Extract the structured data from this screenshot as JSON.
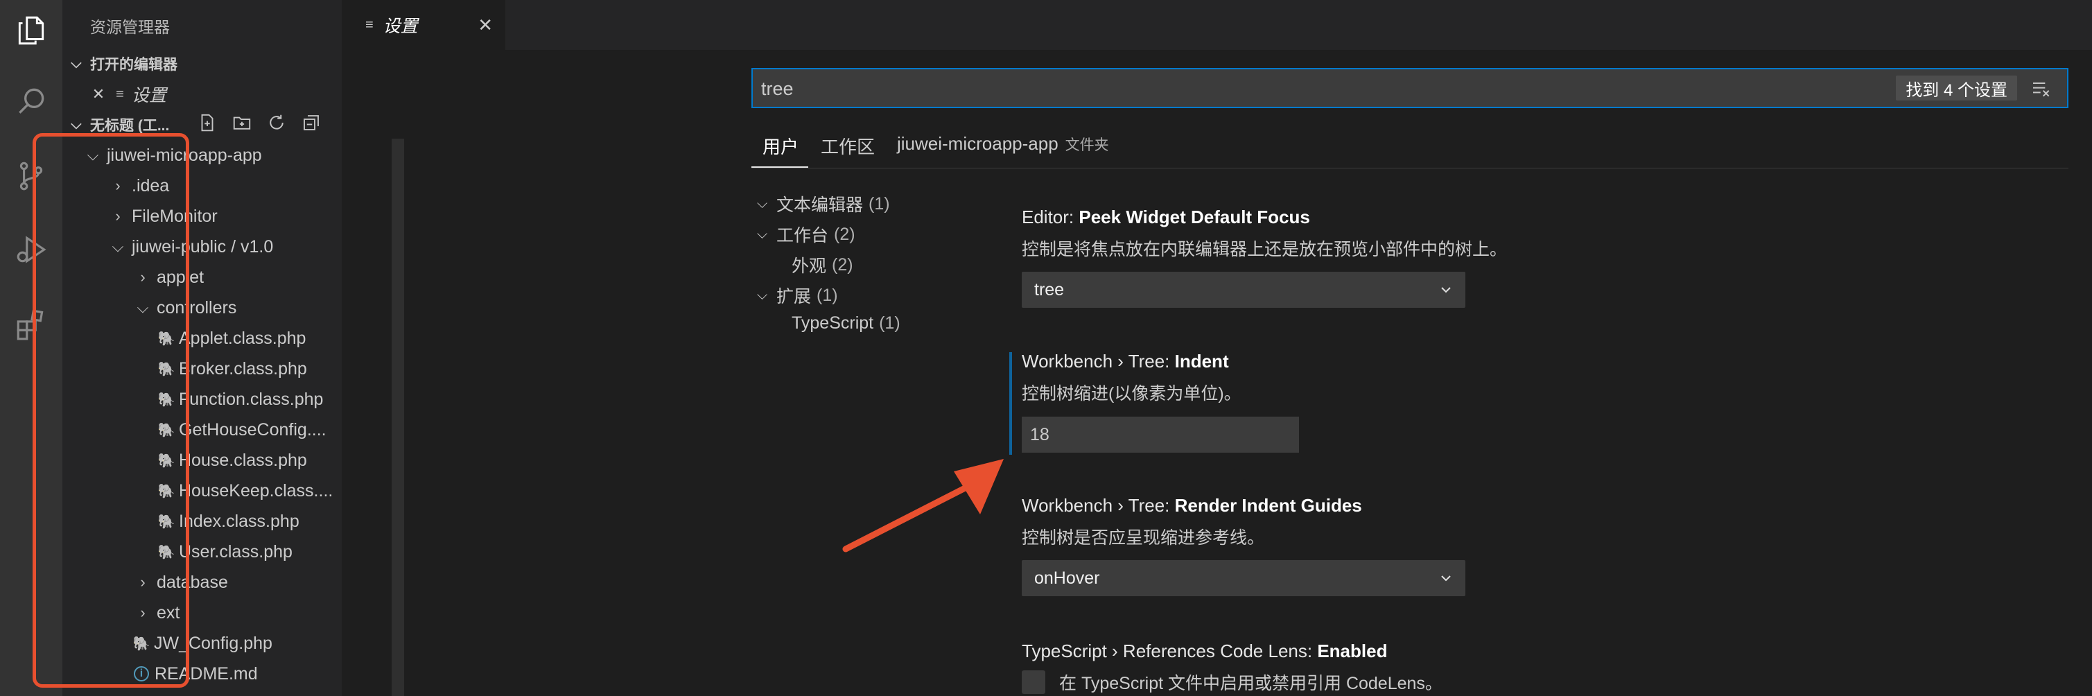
{
  "sidebar": {
    "title": "资源管理器",
    "open_editors_label": "打开的编辑器",
    "open_editor_item": "设置",
    "workspace_label": "无标题 (工...",
    "tree": [
      {
        "label": "jiuwei-microapp-app",
        "kind": "folder-open"
      },
      {
        "label": ".idea",
        "kind": "folder"
      },
      {
        "label": "FileMonitor",
        "kind": "folder"
      },
      {
        "label": "jiuwei-public / v1.0",
        "kind": "folder-open"
      },
      {
        "label": "applet",
        "kind": "folder"
      },
      {
        "label": "controllers",
        "kind": "folder-open"
      },
      {
        "label": "Applet.class.php",
        "kind": "php"
      },
      {
        "label": "Broker.class.php",
        "kind": "php"
      },
      {
        "label": "Function.class.php",
        "kind": "php"
      },
      {
        "label": "GetHouseConfig....",
        "kind": "php"
      },
      {
        "label": "House.class.php",
        "kind": "php"
      },
      {
        "label": "HouseKeep.class....",
        "kind": "php"
      },
      {
        "label": "Index.class.php",
        "kind": "php"
      },
      {
        "label": "User.class.php",
        "kind": "php"
      },
      {
        "label": "database",
        "kind": "folder"
      },
      {
        "label": "ext",
        "kind": "folder"
      },
      {
        "label": "JW_Config.php",
        "kind": "php"
      },
      {
        "label": "README.md",
        "kind": "info"
      }
    ]
  },
  "editor_tab": {
    "label": "设置",
    "close": "✕"
  },
  "settings": {
    "search_value": "tree",
    "found_label": "找到 4 个设置",
    "tabs": [
      {
        "label": "用户"
      },
      {
        "label": "工作区"
      },
      {
        "label": "jiuwei-microapp-app",
        "suffix": "文件夹"
      }
    ],
    "toc": [
      {
        "label": "文本编辑器",
        "count": "(1)"
      },
      {
        "label": "工作台",
        "count": "(2)"
      },
      {
        "label": "外观",
        "count": "(2)"
      },
      {
        "label": "扩展",
        "count": "(1)"
      },
      {
        "label": "TypeScript",
        "count": "(1)"
      }
    ],
    "items": [
      {
        "category": "Editor: ",
        "name": "Peek Widget Default Focus",
        "description": "控制是将焦点放在内联编辑器上还是放在预览小部件中的树上。",
        "value": "tree"
      },
      {
        "category": "Workbench › Tree: ",
        "name": "Indent",
        "description": "控制树缩进(以像素为单位)。",
        "value": "18"
      },
      {
        "category": "Workbench › Tree: ",
        "name": "Render Indent Guides",
        "description": "控制树是否应呈现缩进参考线。",
        "value": "onHover"
      },
      {
        "category": "TypeScript › References Code Lens: ",
        "name": "Enabled",
        "description": "在 TypeScript 文件中启用或禁用引用 CodeLens。"
      }
    ]
  },
  "colors": {
    "accent": "#007acc",
    "annotation": "#e8502f",
    "php": "#a074c4"
  }
}
